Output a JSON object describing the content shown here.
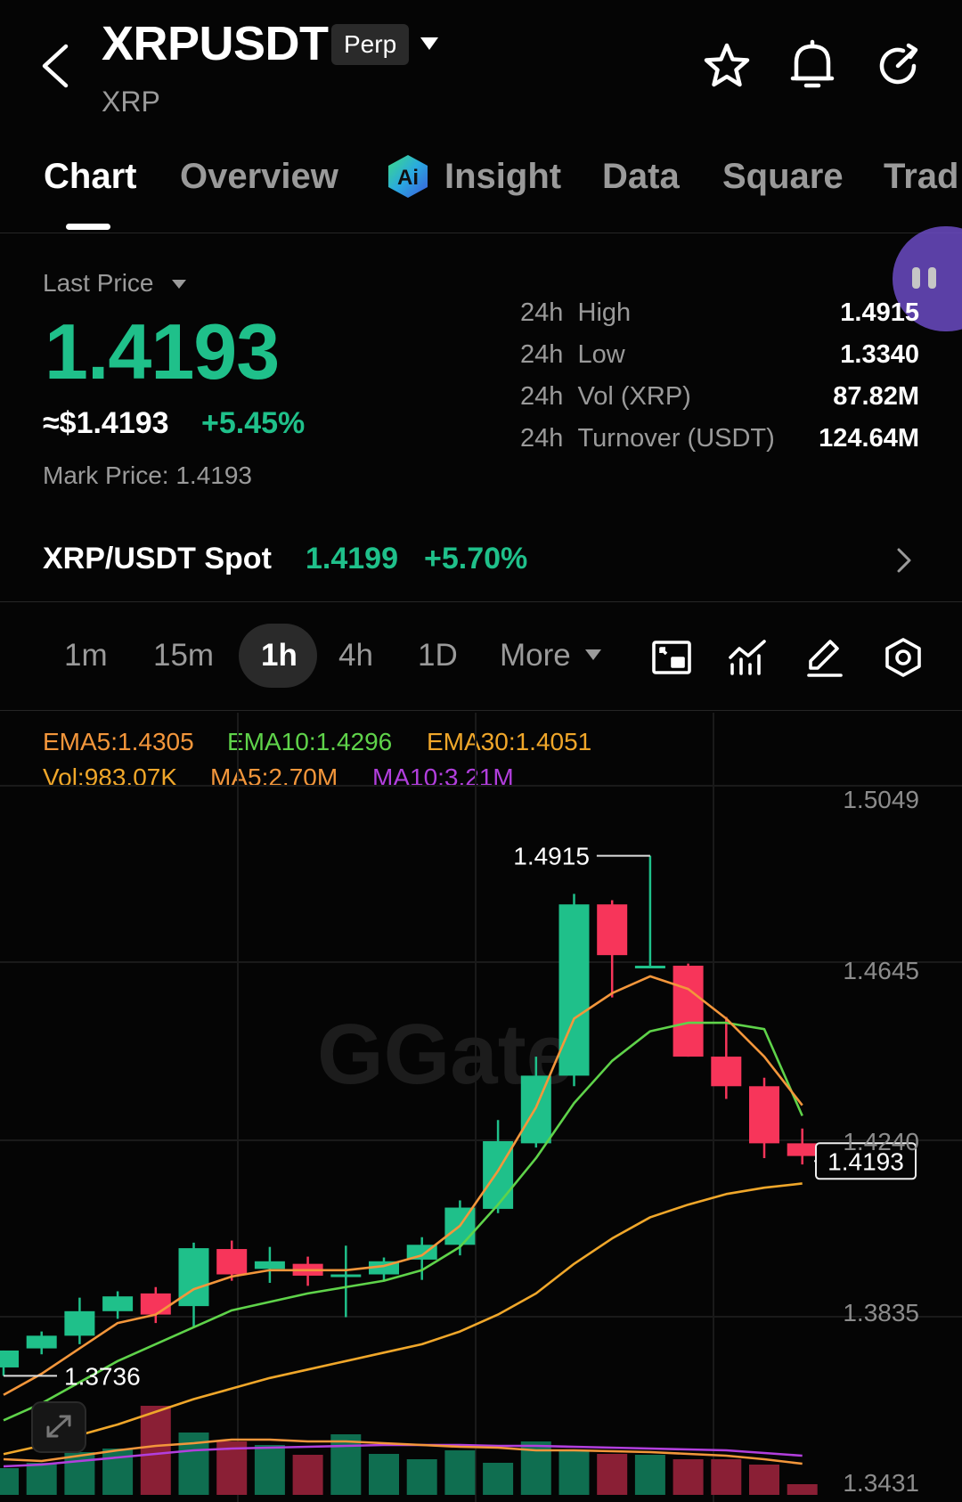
{
  "header": {
    "pair": "XRPUSDT",
    "contract_type": "Perp",
    "base_coin": "XRP"
  },
  "tabs": [
    {
      "label": "Chart",
      "active": true
    },
    {
      "label": "Overview"
    },
    {
      "label": "Insight"
    },
    {
      "label": "Data"
    },
    {
      "label": "Square"
    },
    {
      "label": "Trad"
    }
  ],
  "price": {
    "label": "Last Price",
    "last": "1.4193",
    "usd": "≈$1.4193",
    "change_pct": "+5.45%",
    "mark": "Mark Price: 1.4193"
  },
  "stats": [
    {
      "period": "24h",
      "label": "High",
      "value": "1.4915"
    },
    {
      "period": "24h",
      "label": "Low",
      "value": "1.3340"
    },
    {
      "period": "24h",
      "label": "Vol (XRP)",
      "value": "87.82M"
    },
    {
      "period": "24h",
      "label": "Turnover (USDT)",
      "value": "124.64M"
    }
  ],
  "spot": {
    "label": "XRP/USDT Spot",
    "price": "1.4199",
    "change_pct": "+5.70%"
  },
  "timeframes": [
    {
      "label": "1m"
    },
    {
      "label": "15m"
    },
    {
      "label": "1h",
      "active": true
    },
    {
      "label": "4h"
    },
    {
      "label": "1D"
    },
    {
      "label": "More"
    }
  ],
  "indicators": {
    "ema5": "EMA5:1.4305",
    "ema10": "EMA10:1.4296",
    "ema30": "EMA30:1.4051",
    "vol": "Vol:983.07K",
    "ma5": "MA5:2.70M",
    "ma10": "MA10:3.21M"
  },
  "colors": {
    "up": "#1fc08a",
    "down": "#f7355a",
    "vol_up": "#0f6e50",
    "vol_down": "#8a1f35",
    "ema5": "#f3963b",
    "ema10": "#5fd34a",
    "ema30": "#f0a72a",
    "ma5": "#f3963b",
    "ma10": "#b23fdd"
  },
  "chart_data": {
    "type": "candlestick",
    "price_axis_ticks": [
      "1.5049",
      "1.4645",
      "1.4240",
      "1.3835",
      "1.3431"
    ],
    "ylim": [
      1.3431,
      1.5049
    ],
    "high_marker": "1.4915",
    "low_marker": "1.3736",
    "current_price": "1.4193",
    "grid": true,
    "candles": [
      {
        "o": 1.3705,
        "h": 1.3745,
        "l": 1.3685,
        "c": 1.3745
      },
      {
        "o": 1.375,
        "h": 1.379,
        "l": 1.3736,
        "c": 1.378
      },
      {
        "o": 1.378,
        "h": 1.387,
        "l": 1.376,
        "c": 1.3838
      },
      {
        "o": 1.3838,
        "h": 1.3885,
        "l": 1.382,
        "c": 1.3873
      },
      {
        "o": 1.388,
        "h": 1.3895,
        "l": 1.381,
        "c": 1.383
      },
      {
        "o": 1.385,
        "h": 1.4,
        "l": 1.38,
        "c": 1.3987
      },
      {
        "o": 1.3985,
        "h": 1.4005,
        "l": 1.391,
        "c": 1.3925
      },
      {
        "o": 1.3938,
        "h": 1.399,
        "l": 1.3905,
        "c": 1.3956
      },
      {
        "o": 1.395,
        "h": 1.3967,
        "l": 1.3898,
        "c": 1.3922
      },
      {
        "o": 1.3922,
        "h": 1.3993,
        "l": 1.3824,
        "c": 1.3925
      },
      {
        "o": 1.3925,
        "h": 1.3965,
        "l": 1.391,
        "c": 1.3956
      },
      {
        "o": 1.396,
        "h": 1.4013,
        "l": 1.3912,
        "c": 1.3995
      },
      {
        "o": 1.3995,
        "h": 1.41,
        "l": 1.397,
        "c": 1.4083
      },
      {
        "o": 1.408,
        "h": 1.429,
        "l": 1.407,
        "c": 1.424
      },
      {
        "o": 1.4235,
        "h": 1.444,
        "l": 1.4225,
        "c": 1.4395
      },
      {
        "o": 1.4395,
        "h": 1.4825,
        "l": 1.437,
        "c": 1.48
      },
      {
        "o": 1.48,
        "h": 1.481,
        "l": 1.458,
        "c": 1.468
      },
      {
        "o": 1.4655,
        "h": 1.4915,
        "l": 1.465,
        "c": 1.4655
      },
      {
        "o": 1.4655,
        "h": 1.466,
        "l": 1.444,
        "c": 1.444
      },
      {
        "o": 1.444,
        "h": 1.4534,
        "l": 1.434,
        "c": 1.437
      },
      {
        "o": 1.437,
        "h": 1.439,
        "l": 1.42,
        "c": 1.4235
      },
      {
        "o": 1.4235,
        "h": 1.427,
        "l": 1.4185,
        "c": 1.4205
      }
    ],
    "ema5": [
      1.364,
      1.369,
      1.375,
      1.381,
      1.383,
      1.389,
      1.392,
      1.3935,
      1.3935,
      1.3935,
      1.3945,
      1.397,
      1.404,
      1.417,
      1.432,
      1.453,
      1.459,
      1.463,
      1.46,
      1.453,
      1.444,
      1.4325
    ],
    "ema10": [
      1.358,
      1.362,
      1.367,
      1.372,
      1.376,
      1.38,
      1.384,
      1.386,
      1.388,
      1.3895,
      1.391,
      1.3935,
      1.399,
      1.409,
      1.42,
      1.433,
      1.443,
      1.45,
      1.452,
      1.452,
      1.4505,
      1.43
    ],
    "ema30": [
      1.35,
      1.352,
      1.3545,
      1.357,
      1.36,
      1.363,
      1.3655,
      1.368,
      1.37,
      1.372,
      1.374,
      1.376,
      1.379,
      1.383,
      1.388,
      1.395,
      1.401,
      1.406,
      1.409,
      1.4115,
      1.413,
      1.414
    ],
    "volume_scale": [
      0,
      1
    ],
    "volume": [
      0.3,
      0.36,
      0.48,
      0.52,
      1.0,
      0.7,
      0.6,
      0.56,
      0.45,
      0.68,
      0.46,
      0.4,
      0.5,
      0.36,
      0.6,
      0.5,
      0.46,
      0.45,
      0.4,
      0.4,
      0.34,
      0.12
    ],
    "vol_ma5": [
      0.4,
      0.38,
      0.44,
      0.5,
      0.55,
      0.58,
      0.62,
      0.62,
      0.6,
      0.6,
      0.58,
      0.56,
      0.54,
      0.53,
      0.5,
      0.5,
      0.49,
      0.48,
      0.46,
      0.44,
      0.4,
      0.35
    ],
    "vol_ma10": [
      0.32,
      0.34,
      0.38,
      0.42,
      0.46,
      0.5,
      0.52,
      0.53,
      0.54,
      0.55,
      0.56,
      0.56,
      0.56,
      0.55,
      0.55,
      0.54,
      0.53,
      0.52,
      0.51,
      0.5,
      0.47,
      0.44
    ]
  }
}
